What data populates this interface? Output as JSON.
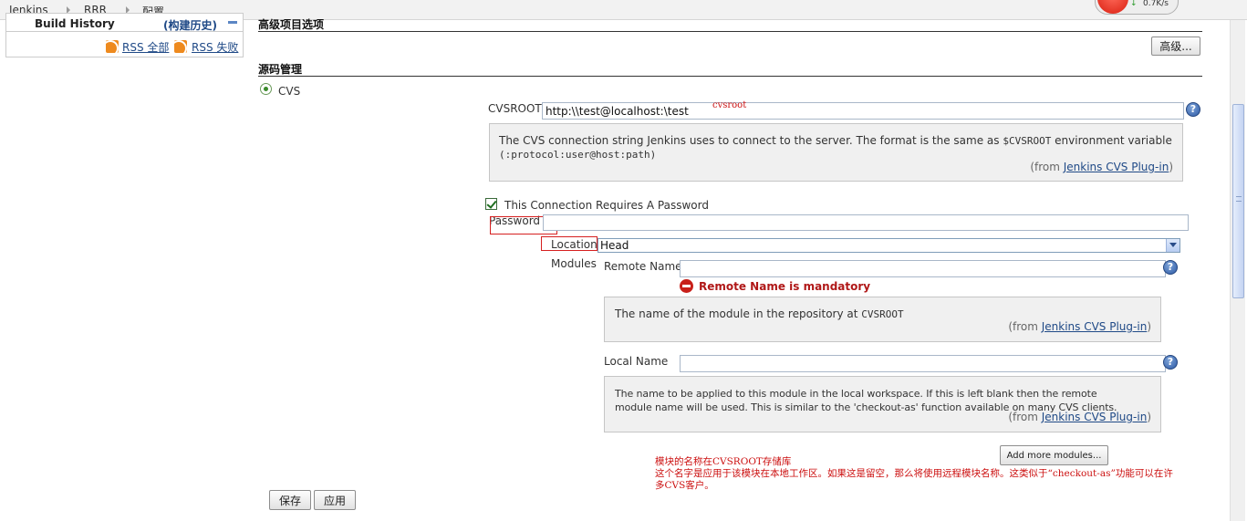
{
  "breadcrumb": [
    "Jenkins",
    "RRR",
    "配置"
  ],
  "network": {
    "speed": "0.7K/s"
  },
  "sidebar": {
    "build_history_title": "Build History",
    "trend_label": "(构建历史)",
    "rss_all": "RSS 全部",
    "rss_failed": "RSS 失败"
  },
  "advanced_section": {
    "title": "高级项目选项",
    "advanced_button": "高级..."
  },
  "scm": {
    "title": "源码管理",
    "cvs_radio_label": "CVS",
    "cvsroot_label": "CVSROOT",
    "cvsroot_value": "http:\\\\test@localhost:\\test",
    "cvsroot_annotation": "cvsroot",
    "cvsroot_help_text": "The CVS connection string Jenkins uses to connect to the server. The format is the same as",
    "cvsroot_help_env": "$CVSROOT",
    "cvsroot_help_text2": "environment variable",
    "cvsroot_help_format": "(:protocol:user@host:path)",
    "from_prefix": "(from ",
    "from_link": "Jenkins CVS Plug-in",
    "from_suffix": ")",
    "password_required_label": "This Connection Requires A Password",
    "password_label": "Password",
    "password_value": "",
    "location_label": "Location",
    "location_value": "Head",
    "modules_label": "Modules",
    "remote_name_label": "Remote Name",
    "remote_name_value": "",
    "remote_name_error": "Remote Name is mandatory",
    "remote_help_text": "The name of the module in the repository at",
    "remote_help_env": "CVSROOT",
    "local_name_label": "Local Name",
    "local_name_value": "",
    "local_help_line1": "The name to be applied to this module in the local workspace. If this is left blank then the remote",
    "local_help_line2": "module name will be used. This is similar to the 'checkout-as' function available on many CVS clients.",
    "add_modules_button": "Add more modules..."
  },
  "annotation": {
    "line1": "模块的名称在CVSROOT存储库",
    "line2": "这个名字是应用于该模块在本地工作区。如果这是留空，那么将使用远程模块名称。这类似于“checkout-as”功能可以在许",
    "line3": "多CVS客户。"
  },
  "footer": {
    "save_button": "保存",
    "apply_button": "应用"
  }
}
